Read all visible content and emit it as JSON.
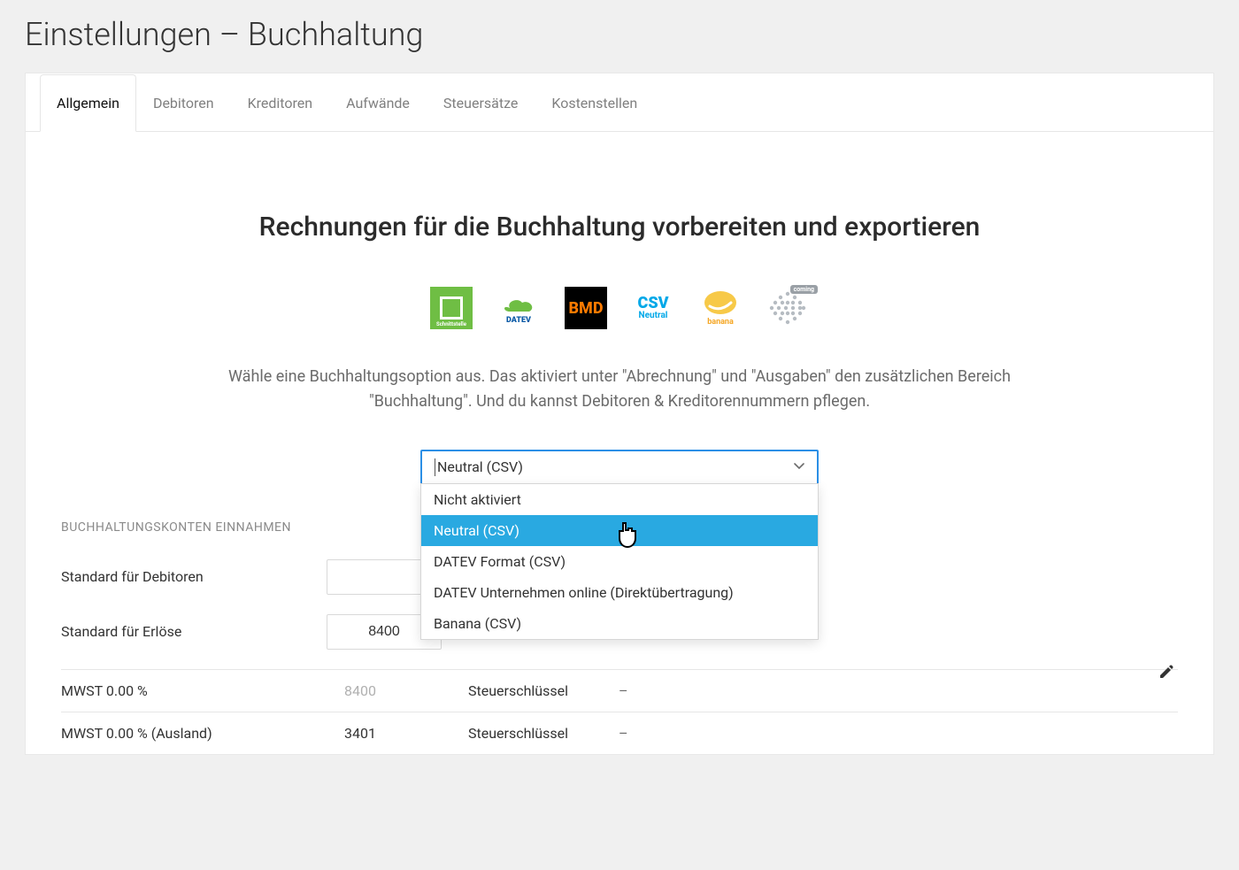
{
  "page_title": "Einstellungen – Buchhaltung",
  "tabs": [
    {
      "label": "Allgemein"
    },
    {
      "label": "Debitoren"
    },
    {
      "label": "Kreditoren"
    },
    {
      "label": "Aufwände"
    },
    {
      "label": "Steuersätze"
    },
    {
      "label": "Kostenstellen"
    }
  ],
  "headline": "Rechnungen für die Buchhaltung vorbereiten und exportieren",
  "logos": {
    "datev_schnittstelle": "Schnittstelle",
    "datev_label": "DATEV",
    "bmd": "BMD",
    "csv": "CSV",
    "csv_sub": "Neutral",
    "banana": "banana",
    "coming": "coming"
  },
  "description": "Wähle eine Buchhaltungsoption aus. Das aktiviert unter \"Abrechnung\" und \"Ausgaben\" den zusätzlichen Bereich \"Buchhaltung\". Und du kannst Debitoren & Kreditorennummern pflegen.",
  "select": {
    "value": "Neutral (CSV)",
    "options": [
      "Nicht aktiviert",
      "Neutral (CSV)",
      "DATEV Format (CSV)",
      "DATEV Unternehmen online (Direktübertragung)",
      "Banana (CSV)"
    ]
  },
  "section_income": {
    "title": "BUCHHALTUNGSKONTEN EINNAHMEN",
    "row_debitoren": {
      "label": "Standard für Debitoren",
      "value": ""
    },
    "row_erloese": {
      "label": "Standard für Erlöse",
      "value": "8400"
    }
  },
  "tax_rows": [
    {
      "label": "MWST 0.00 %",
      "code": "8400",
      "muted": true,
      "key_label": "Steuerschlüssel",
      "key_value": "–"
    },
    {
      "label": "MWST 0.00 % (Ausland)",
      "code": "3401",
      "muted": false,
      "key_label": "Steuerschlüssel",
      "key_value": "–"
    }
  ]
}
